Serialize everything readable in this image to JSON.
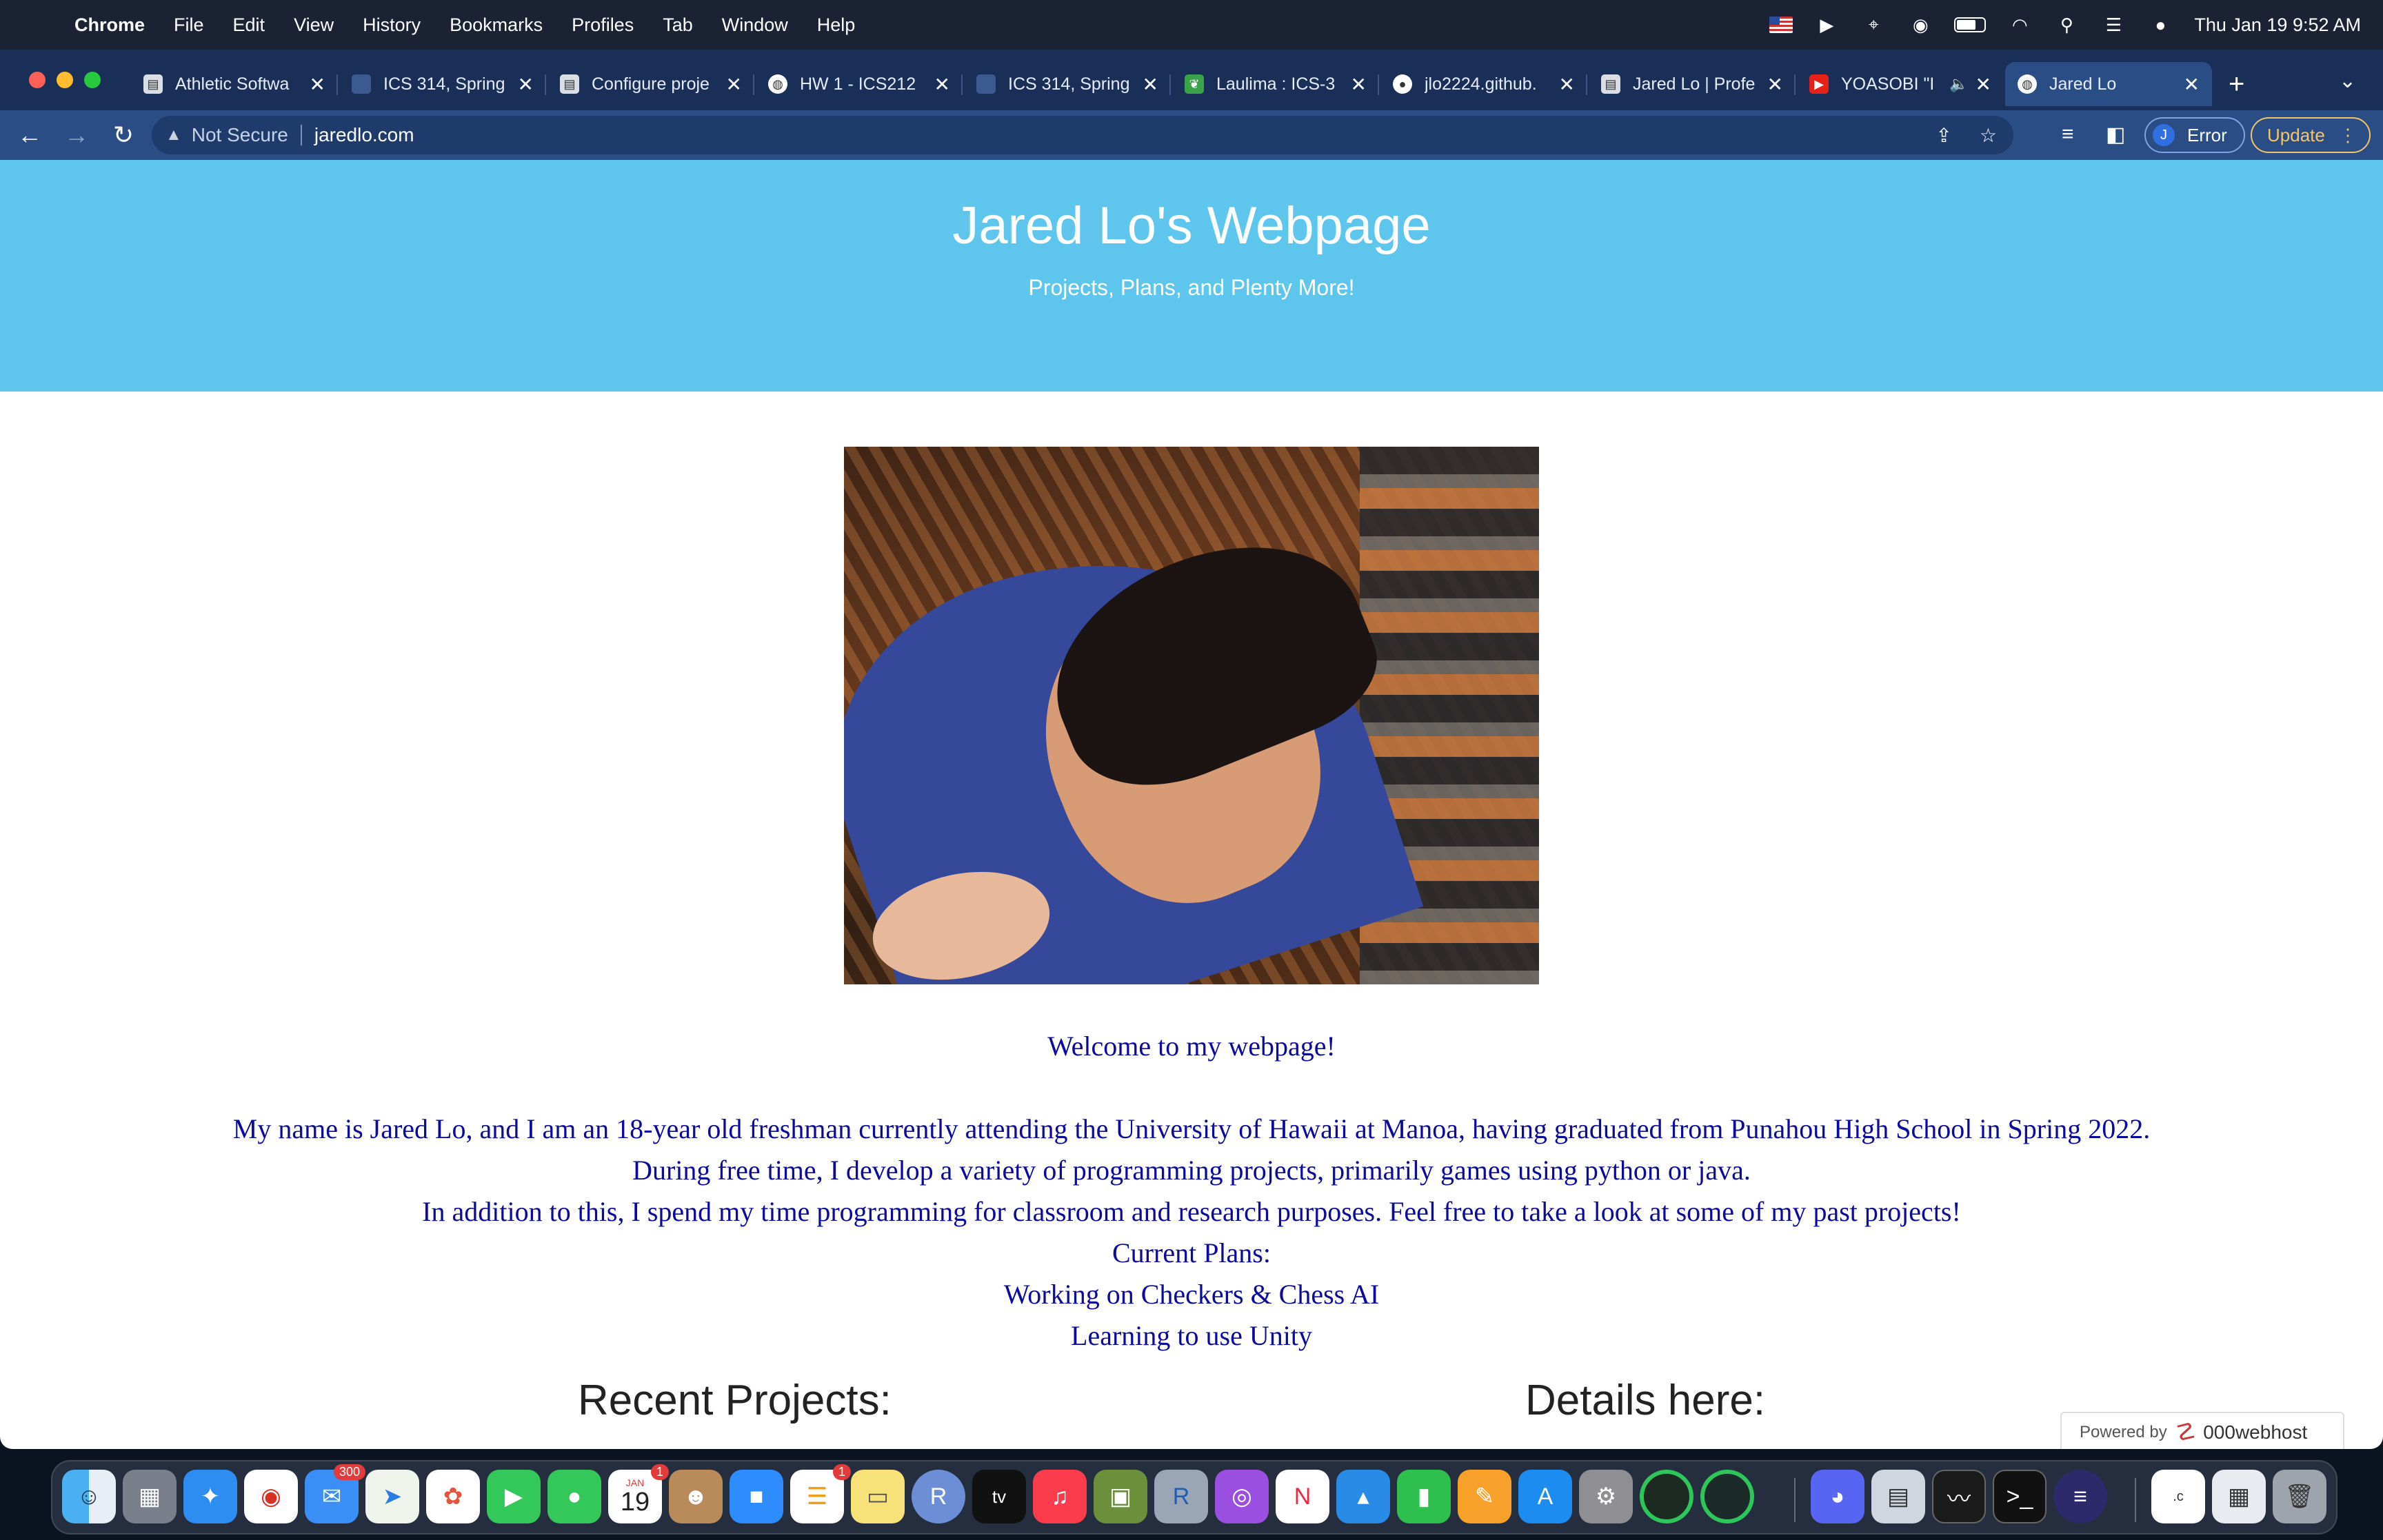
{
  "menubar": {
    "app": "Chrome",
    "items": [
      "File",
      "Edit",
      "View",
      "History",
      "Bookmarks",
      "Profiles",
      "Tab",
      "Window",
      "Help"
    ],
    "clock": "Thu Jan 19  9:52 AM"
  },
  "tabs": [
    {
      "title": "Athletic Softwa",
      "icon": "document-icon"
    },
    {
      "title": "ICS 314, Spring",
      "icon": "square-icon"
    },
    {
      "title": "Configure proje",
      "icon": "document-icon"
    },
    {
      "title": "HW 1 - ICS212",
      "icon": "globe-icon"
    },
    {
      "title": "ICS 314, Spring",
      "icon": "square-icon"
    },
    {
      "title": "Laulima : ICS-3",
      "icon": "leaf-icon"
    },
    {
      "title": "jlo2224.github.",
      "icon": "github-icon"
    },
    {
      "title": "Jared Lo | Profe",
      "icon": "document-icon"
    },
    {
      "title": "YOASOBI \"I",
      "icon": "youtube-icon"
    },
    {
      "title": "Jared Lo",
      "icon": "globe-icon",
      "active": true
    }
  ],
  "toolbar": {
    "security_label": "Not Secure",
    "url": "jaredlo.com",
    "profile_initial": "J",
    "profile_label": "Error",
    "update_label": "Update"
  },
  "page": {
    "title": "Jared Lo's Webpage",
    "subtitle": "Projects, Plans, and Plenty More!",
    "welcome": "Welcome to my webpage!",
    "paragraph": [
      "My name is Jared Lo, and I am an 18-year old freshman currently attending the University of Hawaii at Manoa, having graduated from Punahou High School in Spring 2022.",
      "During free time, I develop a variety of programming projects, primarily games using python or java.",
      "In addition to this, I spend my time programming for classroom and research purposes. Feel free to take a look at some of my past projects!",
      "Current Plans:",
      "Working on Checkers & Chess AI",
      "Learning to use Unity"
    ],
    "recent_projects_heading": "Recent Projects:",
    "details_heading": "Details here:",
    "powered_by": "Powered by",
    "host_brand": "000webhost"
  },
  "dock": {
    "mail_badge": "300",
    "calendar_month": "JAN",
    "calendar_day": "19",
    "calendar_badge": "1",
    "reminders_badge": "1",
    "r_label": "R",
    "tv_label": "tv"
  }
}
